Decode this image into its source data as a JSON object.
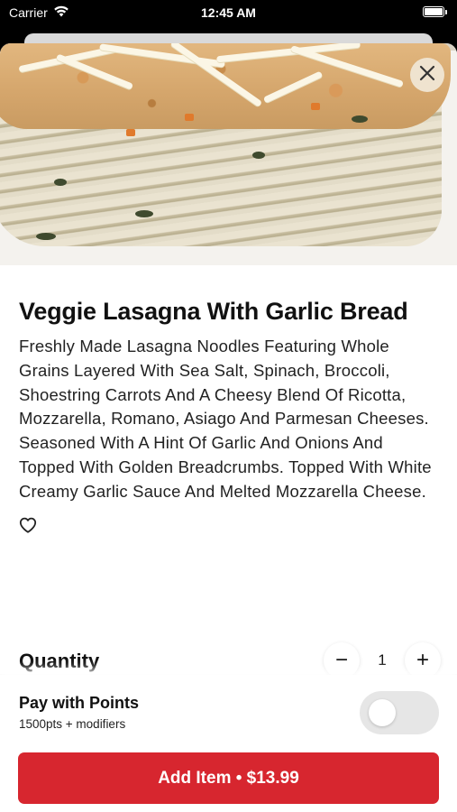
{
  "status_bar": {
    "carrier": "Carrier",
    "time": "12:45 AM",
    "wifi_icon": "wifi-icon",
    "battery_icon": "battery-icon"
  },
  "item": {
    "title": "Veggie Lasagna With Garlic Bread",
    "description": "Freshly Made Lasagna Noodles Featuring Whole Grains Layered With Sea Salt, Spinach, Broccoli, Shoestring Carrots And A Cheesy Blend Of Ricotta, Mozzarella, Romano, Asiago And Parmesan Cheeses. Seasoned With A Hint Of Garlic And Onions And Topped With Golden Breadcrumbs. Topped With White Creamy Garlic Sauce And Melted Mozzarella Cheese.",
    "favorite_icon": "heart-icon",
    "close_icon": "close-icon"
  },
  "quantity": {
    "label": "Quantity",
    "decrement": "−",
    "value": "1",
    "increment": "+"
  },
  "points": {
    "title": "Pay with Points",
    "subtitle": "1500pts + modifiers",
    "toggle_on": false
  },
  "add_button": {
    "label": "Add Item • $13.99"
  },
  "colors": {
    "accent": "#d7262f",
    "close_button_bg": "#efe3cf",
    "toggle_off": "#e6e6e6"
  }
}
